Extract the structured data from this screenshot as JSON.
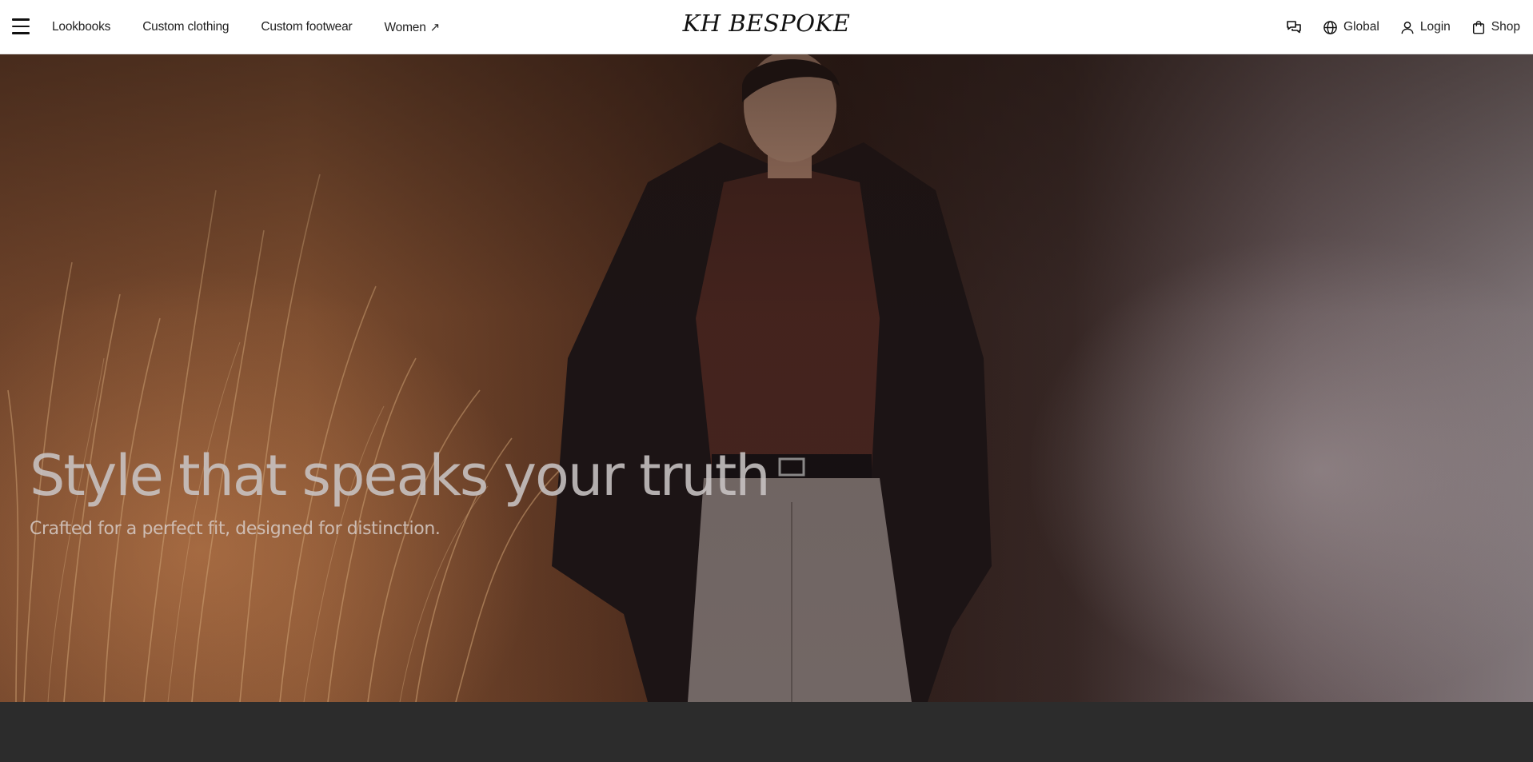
{
  "header": {
    "brand": "KH BESPOKE",
    "nav_left": [
      {
        "label": "Lookbooks"
      },
      {
        "label": "Custom clothing"
      },
      {
        "label": "Custom footwear"
      },
      {
        "label": "Women",
        "icon": "external-arrow-icon"
      }
    ],
    "nav_right": {
      "chat_icon": "chat-bubbles-icon",
      "global_label": "Global",
      "login_label": "Login",
      "shop_label": "Shop"
    }
  },
  "hero": {
    "title": "Style that speaks your truth",
    "subtitle": "Crafted for a perfect fit, designed for distinction."
  },
  "colors": {
    "header_bg": "#ffffff",
    "footer_band": "#2c2c2c",
    "hero_text": "#c8c4c4"
  }
}
